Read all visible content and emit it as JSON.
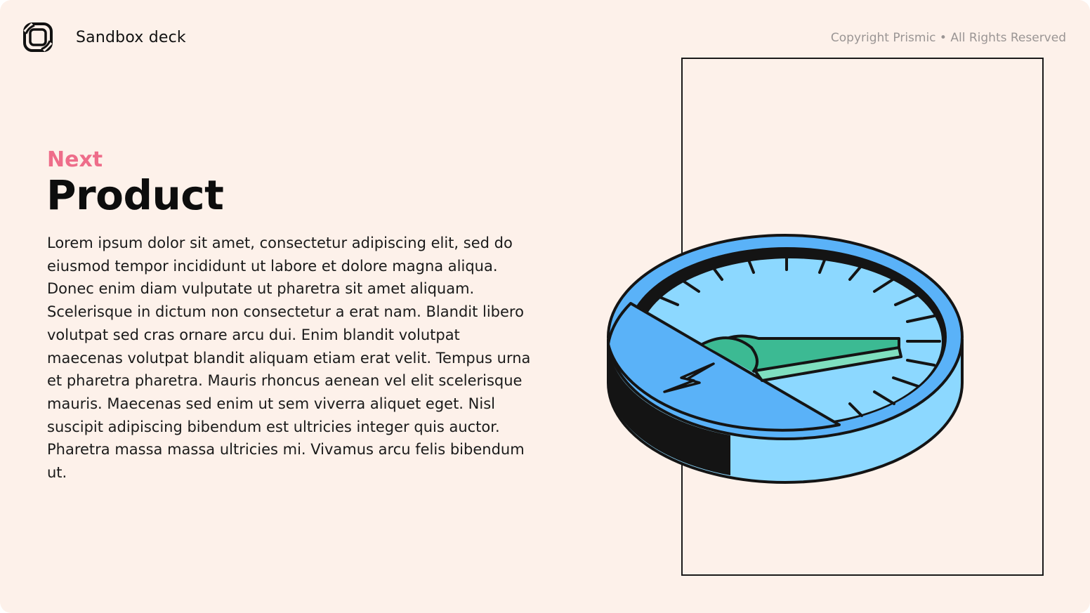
{
  "header": {
    "app_name": "Sandbox deck",
    "logo_icon": "prismic-logo-icon",
    "copyright": "Copyright Prismic • All Rights Reserved"
  },
  "content": {
    "eyebrow": "Next",
    "title": "Product",
    "body": "Lorem ipsum dolor sit amet, consectetur adipiscing elit, sed do eiusmod tempor incididunt ut labore et dolore magna aliqua. Donec enim diam vulputate ut pharetra sit amet aliquam. Scelerisque in dictum non consectetur a erat nam. Blandit libero volutpat sed cras ornare arcu dui. Enim blandit volutpat maecenas volutpat blandit aliquam etiam erat velit. Tempus urna et pharetra pharetra. Mauris rhoncus aenean vel elit scelerisque mauris. Maecenas sed enim ut sem viverra aliquet eget. Nisl suscipit adipiscing bibendum est ultricies integer quis auctor. Pharetra massa massa ultricies mi. Vivamus arcu felis bibendum ut."
  },
  "illustration": {
    "icon": "speed-gauge-icon",
    "colors": {
      "background": "#fdf1ea",
      "accent": "#ee6d8a",
      "gauge_blue": "#5ab2f8",
      "gauge_light_blue": "#8cd8ff",
      "needle_green": "#3cba93",
      "needle_light_green": "#7fdfbf",
      "outline": "#141414"
    }
  }
}
